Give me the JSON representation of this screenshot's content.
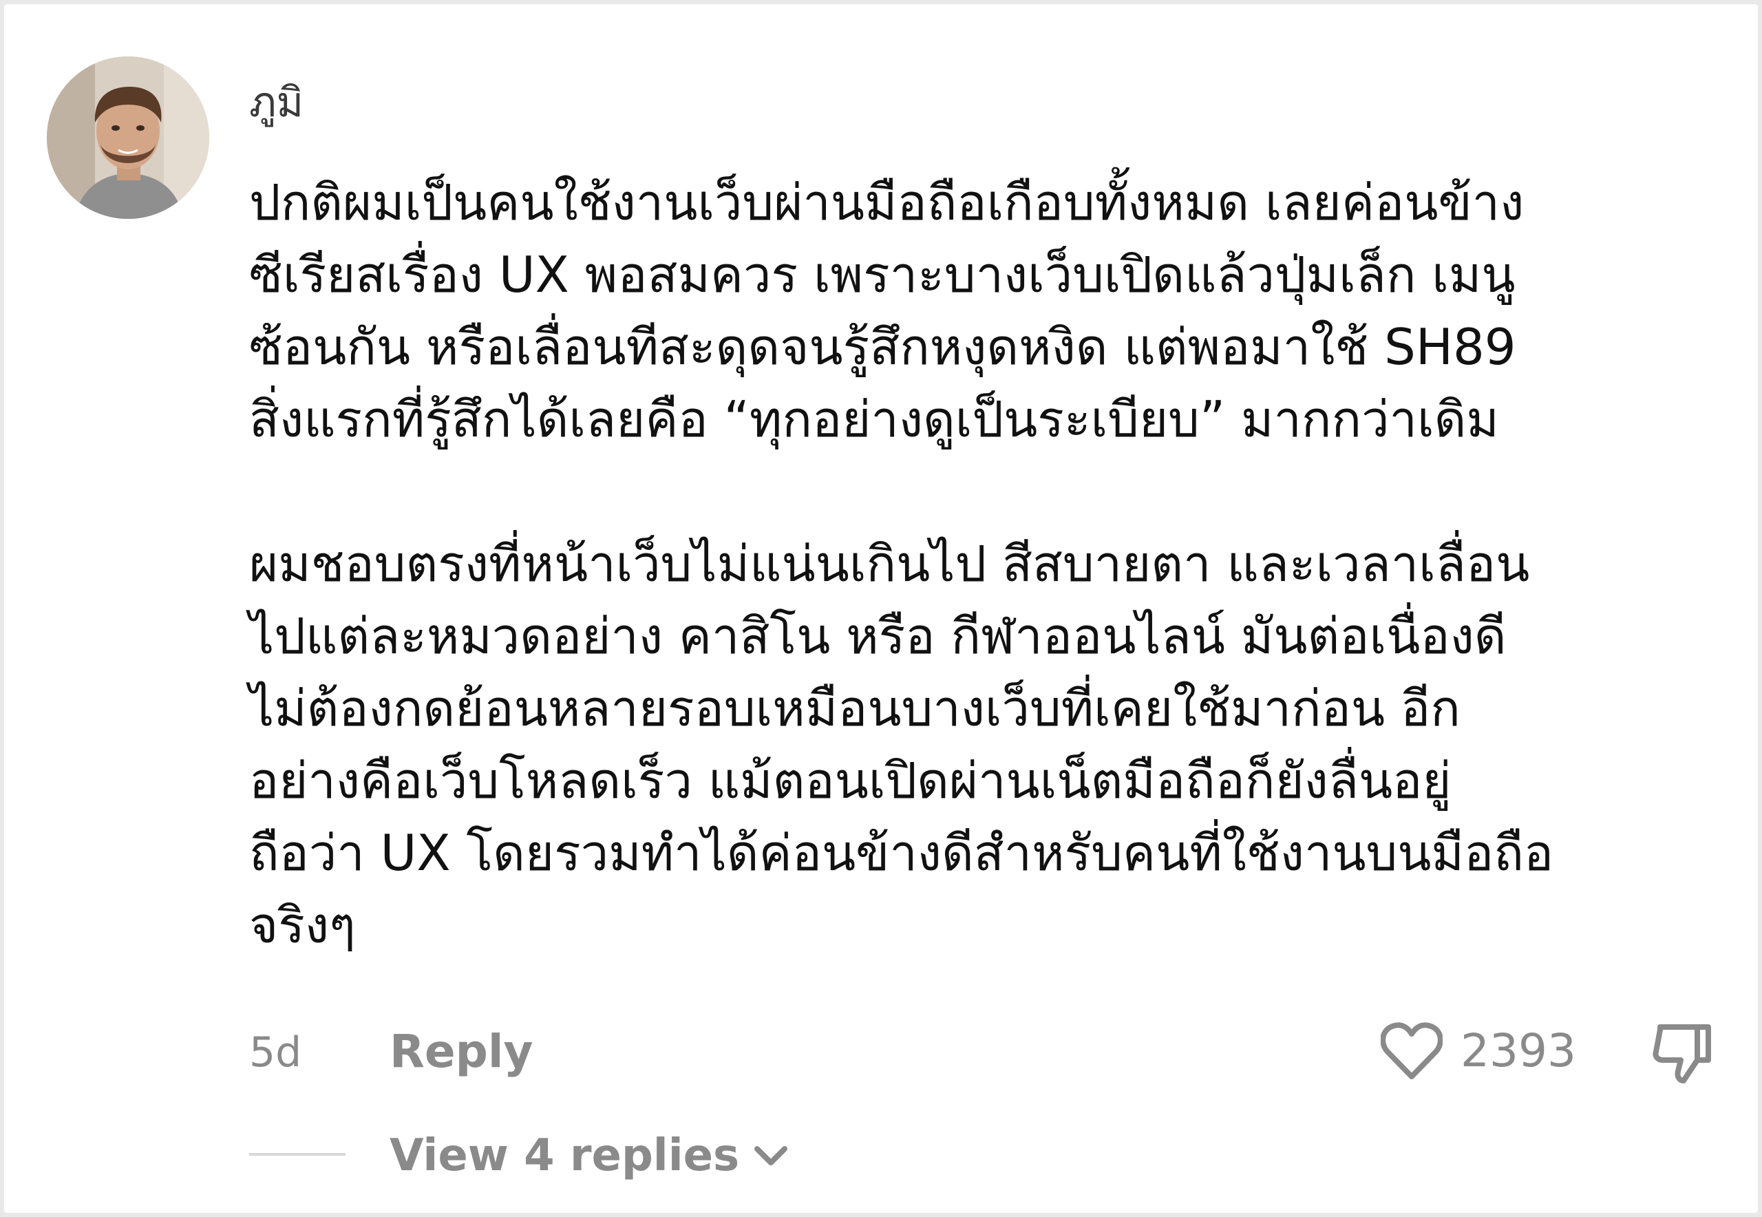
{
  "comment": {
    "author": "ภูมิ",
    "avatar_icon": "user-avatar-photo",
    "paragraphs": [
      [
        "ปกติผมเป็นคนใช้งานเว็บผ่านมือถือเกือบทั้งหมด เลยค่อนข้าง",
        "ซีเรียสเรื่อง UX พอสมควร เพราะบางเว็บเปิดแล้วปุ่มเล็ก เมนู",
        "ซ้อนกัน หรือเลื่อนทีสะดุดจนรู้สึกหงุดหงิด แต่พอมาใช้ SH89",
        "สิ่งแรกที่รู้สึกได้เลยคือ “ทุกอย่างดูเป็นระเบียบ” มากกว่าเดิม"
      ],
      [
        "ผมชอบตรงที่หน้าเว็บไม่แน่นเกินไป สีสบายตา และเวลาเลื่อน",
        "ไปแต่ละหมวดอย่าง คาสิโน หรือ กีฬาออนไลน์ มันต่อเนื่องดี",
        "ไม่ต้องกดย้อนหลายรอบเหมือนบางเว็บที่เคยใช้มาก่อน อีก",
        "อย่างคือเว็บโหลดเร็ว แม้ตอนเปิดผ่านเน็ตมือถือก็ยังลื่นอยู่",
        "ถือว่า UX โดยรวมทำได้ค่อนข้างดีสำหรับคนที่ใช้งานบนมือถือ",
        "จริงๆ"
      ]
    ],
    "time_ago": "5d",
    "reply_label": "Reply",
    "like_count": "2393",
    "like_icon": "heart-outline",
    "dislike_icon": "thumbs-down-outline",
    "view_replies_label": "View 4 replies",
    "view_replies_icon": "chevron-down"
  },
  "colors": {
    "text": "#111111",
    "muted": "#8a8a8a",
    "background": "#ffffff"
  }
}
